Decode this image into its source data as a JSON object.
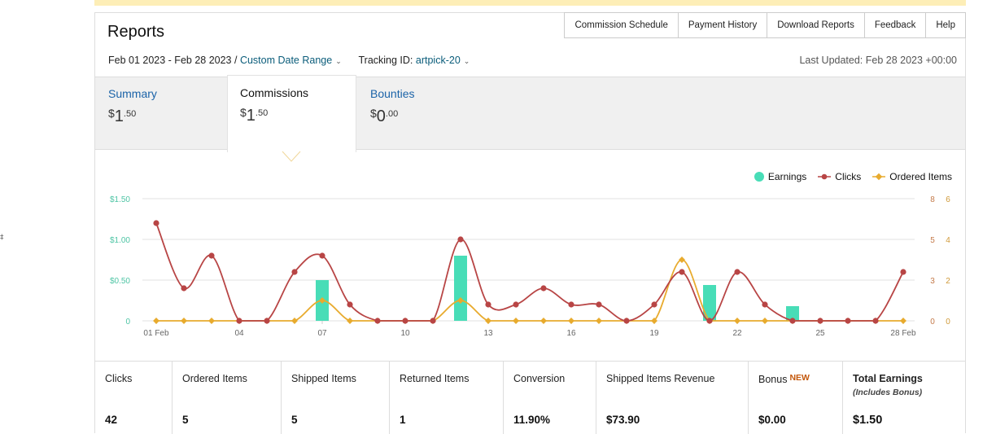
{
  "page": {
    "title": "Reports",
    "stray_glyph": "‡"
  },
  "top_nav": [
    {
      "name": "commission-schedule-link",
      "label": "Commission Schedule"
    },
    {
      "name": "payment-history-link",
      "label": "Payment History"
    },
    {
      "name": "download-reports-link",
      "label": "Download Reports"
    },
    {
      "name": "feedback-link",
      "label": "Feedback"
    },
    {
      "name": "help-link",
      "label": "Help"
    }
  ],
  "filters": {
    "date_range": "Feb 01 2023 - Feb 28 2023",
    "separator": " / ",
    "date_picker_label": "Custom Date Range",
    "tracking_label": "Tracking ID:",
    "tracking_value": "artpick-20",
    "last_updated": "Last Updated: Feb 28 2023 +00:00"
  },
  "summary_tabs": [
    {
      "label": "Summary",
      "currency": "$",
      "whole": "1",
      "cents": ".50",
      "active": false
    },
    {
      "label": "Commissions",
      "currency": "$",
      "whole": "1",
      "cents": ".50",
      "active": true
    },
    {
      "label": "Bounties",
      "currency": "$",
      "whole": "0",
      "cents": ".00",
      "active": false
    }
  ],
  "legend": {
    "earnings": "Earnings",
    "clicks": "Clicks",
    "ordered_items": "Ordered Items"
  },
  "colors": {
    "earnings": "#48ddb7",
    "clicks": "#b84545",
    "ordered_items": "#e8ab2e",
    "link": "#1b63a8",
    "new_badge": "#c4580c"
  },
  "chart_data": {
    "type": "line",
    "x": [
      "01 Feb",
      "02 Feb",
      "03 Feb",
      "04 Feb",
      "05 Feb",
      "06 Feb",
      "07 Feb",
      "08 Feb",
      "09 Feb",
      "10 Feb",
      "11 Feb",
      "12 Feb",
      "13 Feb",
      "14 Feb",
      "15 Feb",
      "16 Feb",
      "17 Feb",
      "18 Feb",
      "19 Feb",
      "20 Feb",
      "21 Feb",
      "22 Feb",
      "23 Feb",
      "24 Feb",
      "25 Feb",
      "26 Feb",
      "27 Feb",
      "28 Feb"
    ],
    "x_tick_labels": [
      "01 Feb",
      "04",
      "07",
      "10",
      "13",
      "16",
      "19",
      "22",
      "25",
      "28 Feb"
    ],
    "series": [
      {
        "name": "Earnings",
        "type": "bar",
        "axis": "left",
        "values": [
          0,
          0,
          0,
          0,
          0,
          0,
          0.5,
          0,
          0,
          0,
          0,
          0.8,
          0,
          0,
          0,
          0,
          0,
          0,
          0,
          0,
          0.44,
          0,
          0,
          0.18,
          0,
          0,
          0,
          0
        ]
      },
      {
        "name": "Clicks",
        "type": "line",
        "axis": "right-clicks",
        "values": [
          6,
          2,
          4,
          0,
          0,
          3,
          4,
          1,
          0,
          0,
          0,
          5,
          1,
          1,
          2,
          1,
          1,
          0,
          1,
          3,
          0,
          3,
          1,
          0,
          0,
          0,
          0,
          3
        ]
      },
      {
        "name": "Ordered Items",
        "type": "line",
        "axis": "right-items",
        "values": [
          0,
          0,
          0,
          0,
          0,
          0,
          1,
          0,
          0,
          0,
          0,
          1,
          0,
          0,
          0,
          0,
          0,
          0,
          0,
          3,
          0,
          0,
          0,
          0,
          0,
          0,
          0,
          0
        ]
      }
    ],
    "y_left": {
      "ticks": [
        "0",
        "$0.50",
        "$1.00",
        "$1.50"
      ],
      "range": [
        0,
        1.5
      ]
    },
    "y_right_clicks": {
      "ticks": [
        "0",
        "3",
        "5",
        "8"
      ],
      "range": [
        0,
        7.5
      ]
    },
    "y_right_items": {
      "ticks": [
        "0",
        "2",
        "4",
        "6"
      ],
      "range": [
        0,
        6
      ]
    },
    "grid": true,
    "legend_position": "top-right"
  },
  "stats": [
    {
      "label": "Clicks",
      "value": "42"
    },
    {
      "label": "Ordered Items",
      "value": "5"
    },
    {
      "label": "Shipped Items",
      "value": "5"
    },
    {
      "label": "Returned Items",
      "value": "1"
    },
    {
      "label": "Conversion",
      "value": "11.90%"
    },
    {
      "label": "Shipped Items Revenue",
      "value": "$73.90"
    },
    {
      "label": "Bonus",
      "badge": "NEW",
      "value": "$0.00"
    },
    {
      "label": "Total Earnings",
      "note": "(Includes Bonus)",
      "value": "$1.50"
    }
  ]
}
